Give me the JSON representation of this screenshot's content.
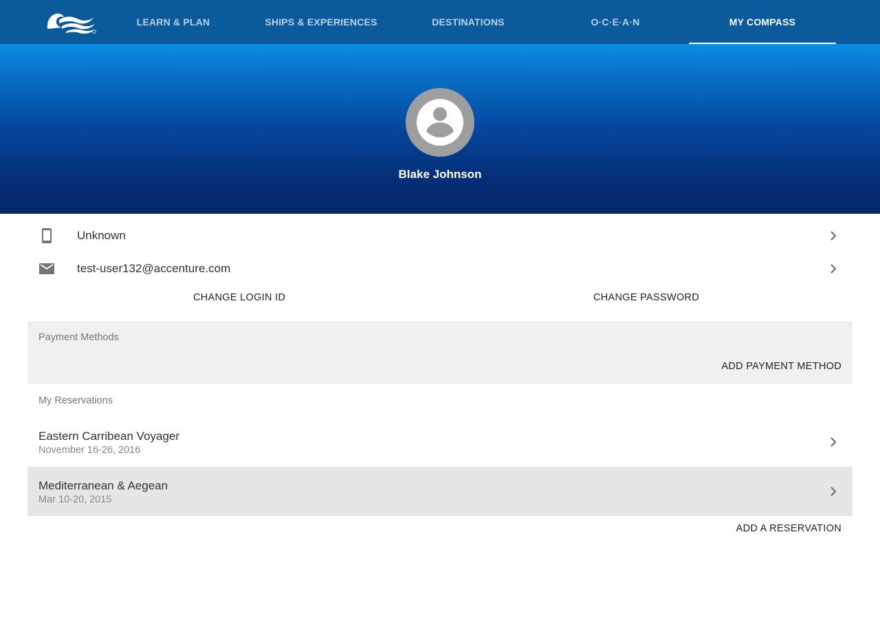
{
  "nav": {
    "logo_icon": "princess-cruises-seawitch-logo",
    "items": [
      {
        "label": "LEARN & PLAN"
      },
      {
        "label": "SHIPS & EXPERIENCES"
      },
      {
        "label": "DESTINATIONS"
      },
      {
        "label": "O·C·E·A·N"
      },
      {
        "label": "MY COMPASS",
        "active": true
      }
    ]
  },
  "profile": {
    "avatar_icon": "account-circle-icon",
    "name": "Blake Johnson"
  },
  "contact": {
    "phone": {
      "icon": "smartphone-icon",
      "value": "Unknown"
    },
    "email": {
      "icon": "email-icon",
      "value": "test-user132@accenture.com"
    }
  },
  "actions": {
    "change_login": "CHANGE LOGIN ID",
    "change_password": "CHANGE PASSWORD"
  },
  "payment": {
    "heading": "Payment Methods",
    "add_label": "ADD PAYMENT METHOD"
  },
  "reservations": {
    "heading": "My Reservations",
    "items": [
      {
        "title": "Eastern Carribean Voyager",
        "dates": "November 16-26, 2016"
      },
      {
        "title": "Mediterranean & Aegean",
        "dates": "Mar 10-20, 2015"
      }
    ],
    "add_label": "ADD A RESERVATION"
  },
  "colors": {
    "nav_bg": "#0a5a9c",
    "nav_text": "#b9d3ec",
    "hero_top": "#0a8ee6",
    "hero_bottom": "#042766",
    "avatar_bg": "#9e9e9e",
    "panel_bg": "#f0f0f0",
    "row_alt_bg": "#e6e6e6"
  }
}
